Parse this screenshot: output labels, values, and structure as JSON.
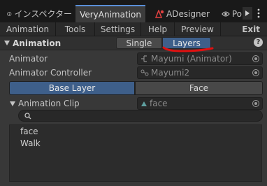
{
  "tabs": [
    {
      "label": "インスペクター",
      "icon": "info-icon"
    },
    {
      "label": "VeryAnimation",
      "active": true
    },
    {
      "label": "ADesigner",
      "icon": "adesigner-icon"
    },
    {
      "label": "Po",
      "icon": "eye-icon"
    }
  ],
  "toolbar": {
    "animation": "Animation",
    "tools": "Tools",
    "settings": "Settings",
    "help": "Help",
    "preview": "Preview",
    "exit": "Exit"
  },
  "section": {
    "title": "Animation",
    "single": "Single",
    "layers": "Layers",
    "selected_mode": "Layers"
  },
  "fields": {
    "animator_label": "Animator",
    "animator_value": "Mayumi (Animator)",
    "controller_label": "Animator Controller",
    "controller_value": "Mayumi2"
  },
  "layers": {
    "base": "Base Layer",
    "face": "Face",
    "selected": "Base Layer"
  },
  "clip": {
    "label": "Animation Clip",
    "value": "face",
    "search_placeholder": ""
  },
  "clip_list": [
    "face",
    "Walk"
  ],
  "colors": {
    "accent": "#3e5f8a",
    "annotation": "#e01010",
    "tab_highlight": "#5a8fd8"
  }
}
